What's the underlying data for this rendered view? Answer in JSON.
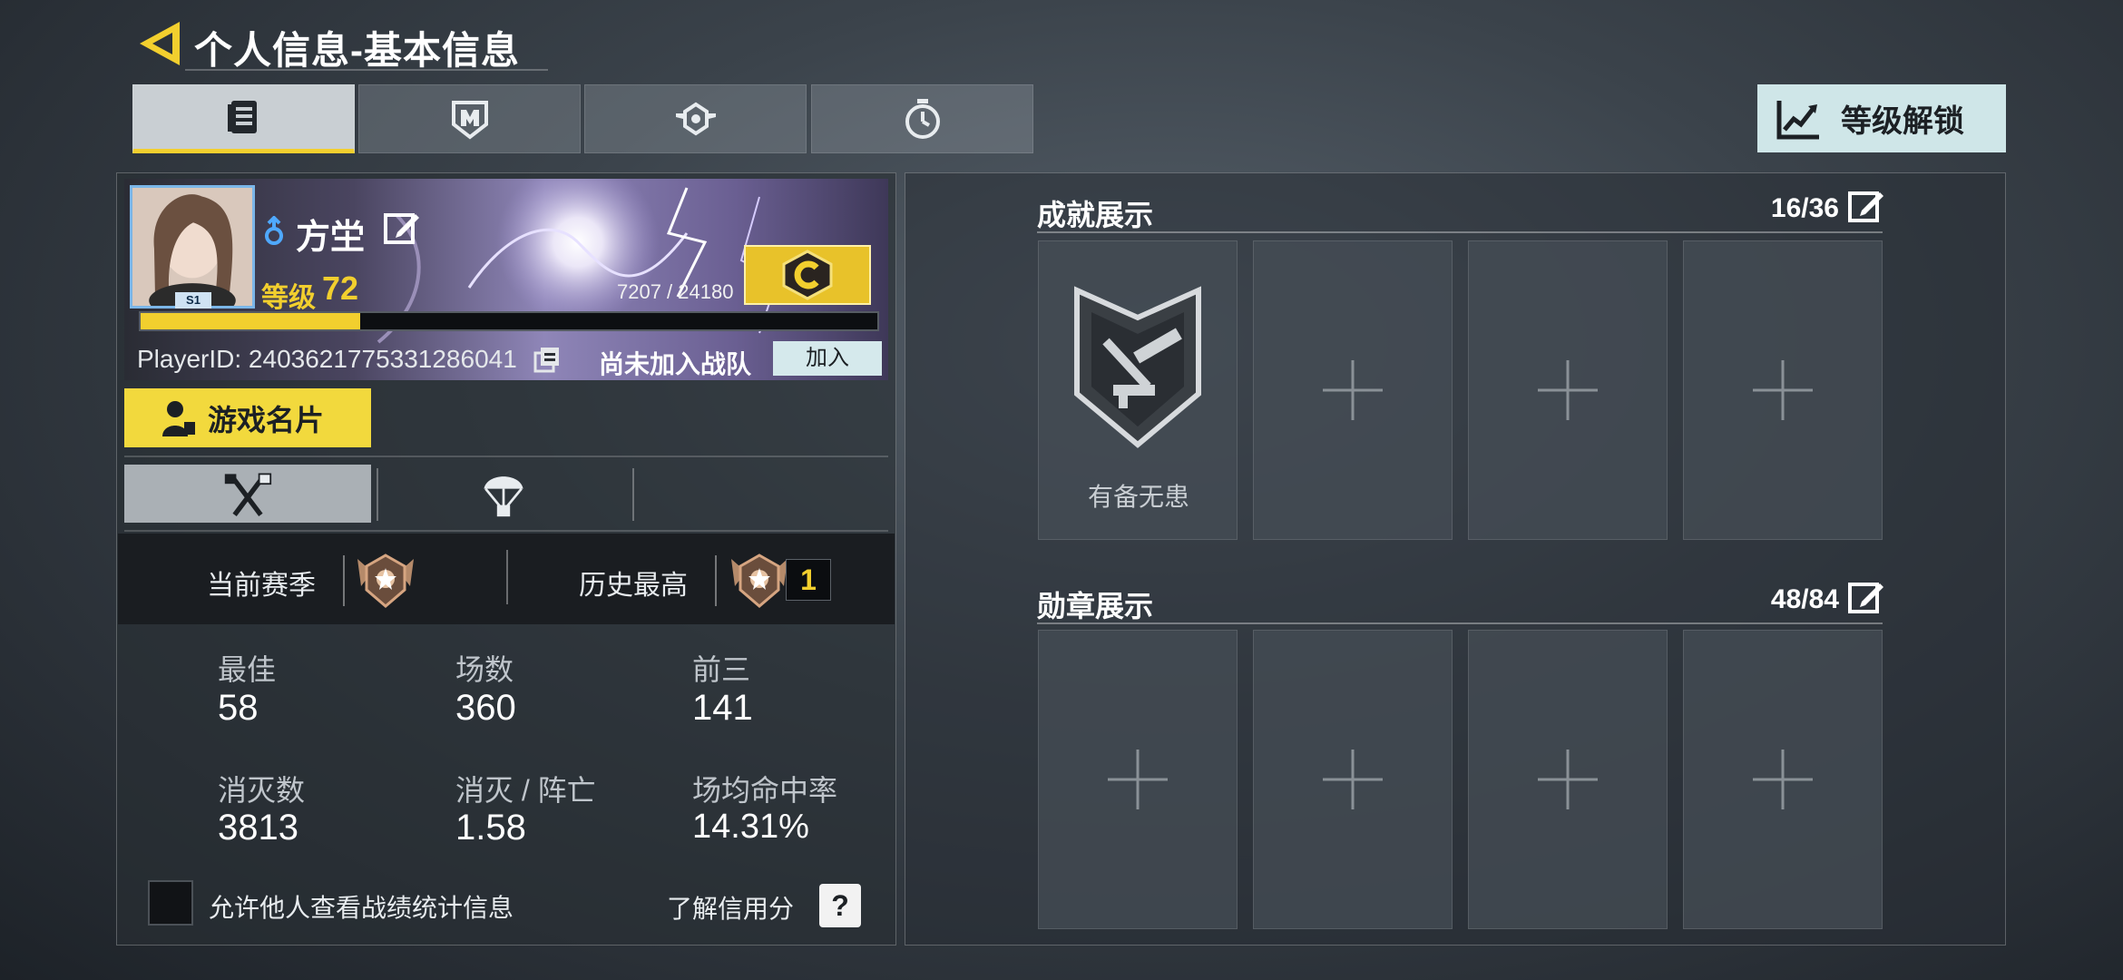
{
  "title": "个人信息-基本信息",
  "tabs": [
    {
      "icon": "profile-card-icon",
      "active": true
    },
    {
      "icon": "shield-emblem-icon",
      "active": false
    },
    {
      "icon": "winged-badge-icon",
      "active": false
    },
    {
      "icon": "stopwatch-icon",
      "active": false
    }
  ],
  "unlock_button": {
    "label": "等级解锁",
    "icon": "trend-chart-icon"
  },
  "profile": {
    "name": "方坣",
    "gender_icon": "male-icon",
    "level_label": "等级",
    "level": "72",
    "xp_text": "7207 / 24180",
    "xp_progress": 0.298,
    "avatar_badge": "S1",
    "player_id": "PlayerID: 2403621775331286041",
    "team_status": "尚未加入战队",
    "join_label": "加入",
    "rank_icon": "rank-c-emblem-icon"
  },
  "card_button": {
    "label": "游戏名片"
  },
  "mode_tabs": [
    {
      "icon": "crossed-weapons-icon",
      "active": true
    },
    {
      "icon": "parachute-icon",
      "active": false
    }
  ],
  "season": {
    "current_label": "当前赛季",
    "history_label": "历史最高",
    "history_rank": "1"
  },
  "stats": [
    {
      "label": "最佳",
      "value": "58"
    },
    {
      "label": "场数",
      "value": "360"
    },
    {
      "label": "前三",
      "value": "141"
    },
    {
      "label": "消灭数",
      "value": "3813"
    },
    {
      "label": "消灭 / 阵亡",
      "value": "1.58"
    },
    {
      "label": "场均命中率",
      "value": "14.31%"
    }
  ],
  "allow_stats_label": "允许他人查看战绩统计信息",
  "credit_label": "了解信用分",
  "help_label": "?",
  "achievements": {
    "title": "成就展示",
    "count": "16/36",
    "first_item": "有备无患"
  },
  "medals": {
    "title": "勋章展示",
    "count": "48/84"
  },
  "colors": {
    "accent_yellow": "#f2cf2e",
    "button_cyan": "#cfe6e8"
  }
}
